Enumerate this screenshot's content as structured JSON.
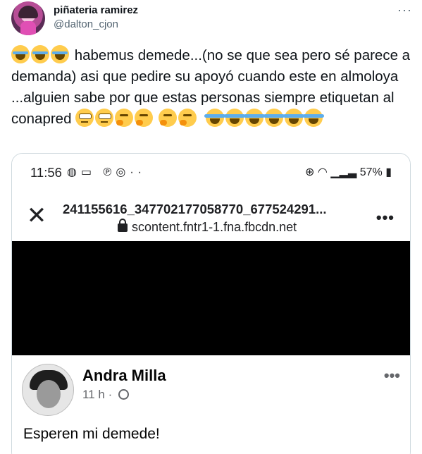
{
  "tweet": {
    "display_name": "piñateria ramirez",
    "handle": "@dalton_cjon",
    "more_label": "···",
    "text_part1": "habemus demede...(no se que sea pero sé parece a demanda) asi que pedire su apoyó cuando este en almoloya ...alguien sabe por que estas personas siempre etiquetan al conapred",
    "emojis_lead": [
      "loudly-crying-face",
      "loudly-crying-face",
      "loudly-crying-face"
    ],
    "emojis_mid": [
      "face-with-rolling-eyes",
      "face-with-rolling-eyes",
      "thinking-face",
      "thinking-face",
      "thinking-face",
      "thinking-face"
    ],
    "emojis_tail": [
      "face-with-tears-of-joy",
      "face-with-tears-of-joy",
      "face-with-tears-of-joy",
      "face-with-tears-of-joy",
      "face-with-tears-of-joy",
      "face-with-tears-of-joy"
    ]
  },
  "screenshot": {
    "status_bar": {
      "time": "11:56",
      "left_icons": [
        "messenger-icon",
        "chat-icon",
        "pinterest-icon",
        "instagram-icon",
        "more-dots-icon"
      ],
      "battery": "57%",
      "right_icons": [
        "location-icon",
        "wifi-icon",
        "signal-icon",
        "battery-icon"
      ]
    },
    "browser": {
      "file_title": "241155616_347702177058770_677524291...",
      "domain": "scontent.fntr1-1.fna.fbcdn.net"
    },
    "fb_post": {
      "author": "Andra Milla",
      "time": "11 h",
      "dot": "·",
      "text": "Esperen mi demede!"
    }
  }
}
